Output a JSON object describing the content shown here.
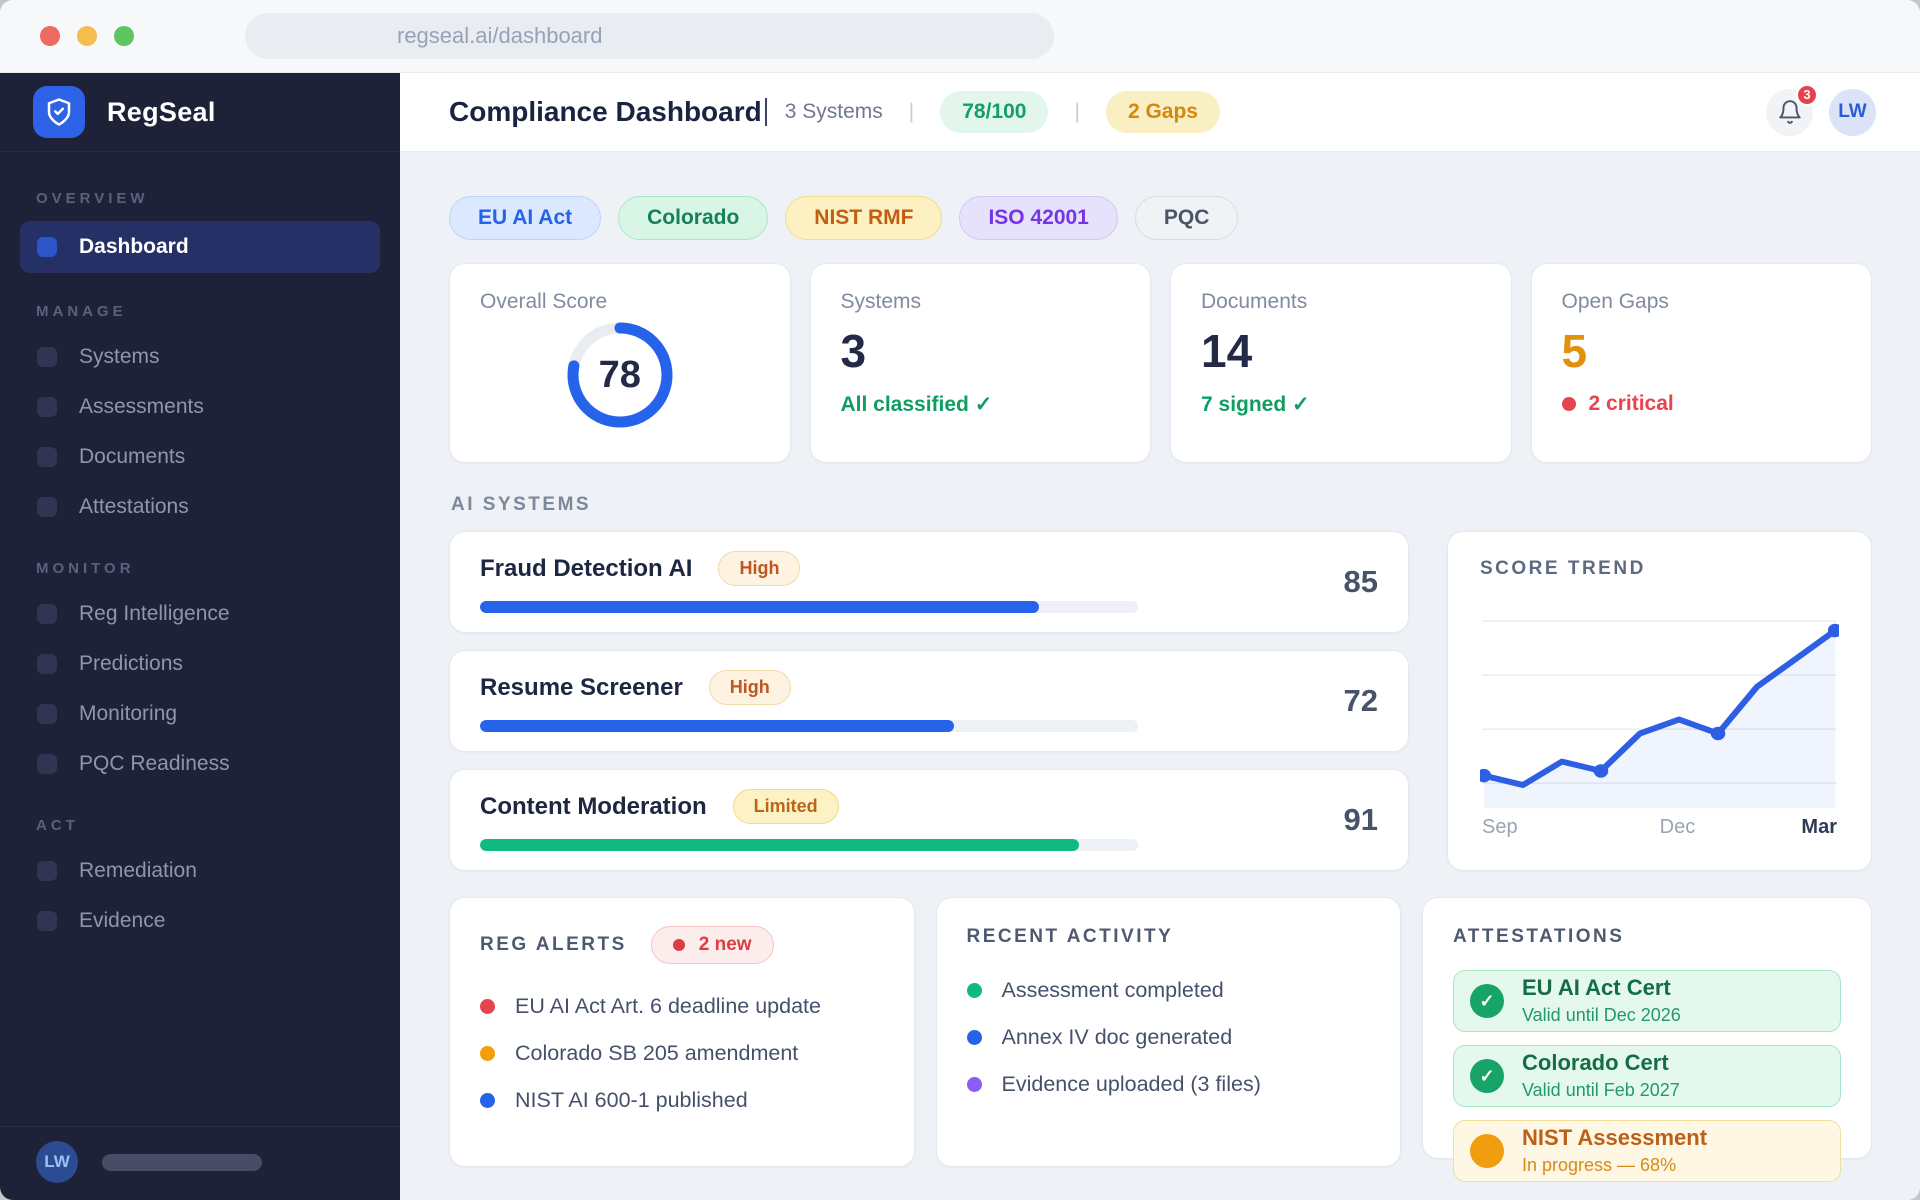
{
  "browser": {
    "url": "regseal.ai/dashboard"
  },
  "sidebar": {
    "brand": "RegSeal",
    "sections": [
      {
        "label": "OVERVIEW",
        "items": [
          {
            "label": "Dashboard",
            "active": true
          }
        ]
      },
      {
        "label": "MANAGE",
        "items": [
          {
            "label": "Systems"
          },
          {
            "label": "Assessments"
          },
          {
            "label": "Documents"
          },
          {
            "label": "Attestations"
          }
        ]
      },
      {
        "label": "MONITOR",
        "items": [
          {
            "label": "Reg Intelligence"
          },
          {
            "label": "Predictions"
          },
          {
            "label": "Monitoring"
          },
          {
            "label": "PQC Readiness"
          }
        ]
      },
      {
        "label": "ACT",
        "items": [
          {
            "label": "Remediation"
          },
          {
            "label": "Evidence"
          }
        ]
      }
    ],
    "user_initials": "LW"
  },
  "header": {
    "title": "Compliance Dashboard",
    "systems_summary": "3 Systems",
    "separator": "|",
    "score_badge": {
      "label": "78/100",
      "bg": "#e2f6eb",
      "color": "#149e68"
    },
    "gaps_badge": {
      "label": "2 Gaps",
      "bg": "#faeec3",
      "color": "#d1880e"
    },
    "notification_count": "3",
    "avatar_initials": "LW"
  },
  "filters": [
    {
      "label": "EU AI Act",
      "bg": "#dce8fd",
      "border": "#bcd3fb",
      "color": "#2563eb"
    },
    {
      "label": "Colorado",
      "bg": "#d8f5e5",
      "border": "#a9e8c9",
      "color": "#15805b"
    },
    {
      "label": "NIST RMF",
      "bg": "#fdf0c2",
      "border": "#f4dd8a",
      "color": "#c25e11"
    },
    {
      "label": "ISO 42001",
      "bg": "#e6e2fc",
      "border": "#cfc7f8",
      "color": "#7634e6"
    },
    {
      "label": "PQC",
      "bg": "#f0f2f5",
      "border": "#d8dde5",
      "color": "#4c5568"
    }
  ],
  "stats": {
    "overall": {
      "label": "Overall Score",
      "value": 78,
      "ring_color": "#2563eb"
    },
    "systems": {
      "label": "Systems",
      "value": "3",
      "sub": "All classified ✓",
      "sub_color": "#0f9d61"
    },
    "documents": {
      "label": "Documents",
      "value": "14",
      "sub": "7 signed ✓",
      "sub_color": "#0f9d61"
    },
    "gaps": {
      "label": "Open Gaps",
      "value": "5",
      "value_color": "#e0920f",
      "sub": "2 critical",
      "sub_color": "#e8444d",
      "dot_color": "#e8444d"
    }
  },
  "ai_systems": {
    "heading": "AI SYSTEMS",
    "rows": [
      {
        "name": "Fraud Detection AI",
        "badge": "High",
        "badge_style": "high",
        "score": "85",
        "pct": 85,
        "bar_color": "#2563eb"
      },
      {
        "name": "Resume Screener",
        "badge": "High",
        "badge_style": "high",
        "score": "72",
        "pct": 72,
        "bar_color": "#2563eb"
      },
      {
        "name": "Content Moderation",
        "badge": "Limited",
        "badge_style": "limited",
        "score": "91",
        "pct": 91,
        "bar_color": "#10b981"
      }
    ]
  },
  "chart_data": {
    "type": "line",
    "title": "SCORE TREND",
    "x_tick_labels": [
      "Sep",
      "Dec",
      "Mar"
    ],
    "values": [
      47,
      45,
      50,
      48,
      56,
      59,
      56,
      66,
      72,
      78
    ],
    "marker_indices": [
      0,
      3,
      6,
      9
    ],
    "ylim": [
      40,
      82
    ],
    "grid": true,
    "legend": false,
    "line_color": "#2e5ee3",
    "area_fill": "rgba(46,94,227,0.07)",
    "grid_color": "#e7ebf1"
  },
  "reg_alerts": {
    "heading": "REG ALERTS",
    "badge": "2 new",
    "items": [
      {
        "text": "EU AI Act Art. 6 deadline update",
        "dot": "#e8444d"
      },
      {
        "text": "Colorado SB 205 amendment",
        "dot": "#f59e0b"
      },
      {
        "text": "NIST AI 600-1 published",
        "dot": "#2563eb"
      }
    ]
  },
  "recent_activity": {
    "heading": "RECENT ACTIVITY",
    "items": [
      {
        "text": "Assessment completed",
        "dot": "#10b981"
      },
      {
        "text": "Annex IV doc generated",
        "dot": "#2563eb"
      },
      {
        "text": "Evidence uploaded (3 files)",
        "dot": "#8b5cf6"
      }
    ]
  },
  "attestations": {
    "heading": "ATTESTATIONS",
    "items": [
      {
        "title": "EU AI Act Cert",
        "subtitle": "Valid until Dec 2026",
        "status": "valid",
        "icon": "✓"
      },
      {
        "title": "Colorado Cert",
        "subtitle": "Valid until Feb 2027",
        "status": "valid",
        "icon": "✓"
      },
      {
        "title": "NIST Assessment",
        "subtitle": "In progress — 68%",
        "status": "progress",
        "icon": ""
      }
    ]
  }
}
